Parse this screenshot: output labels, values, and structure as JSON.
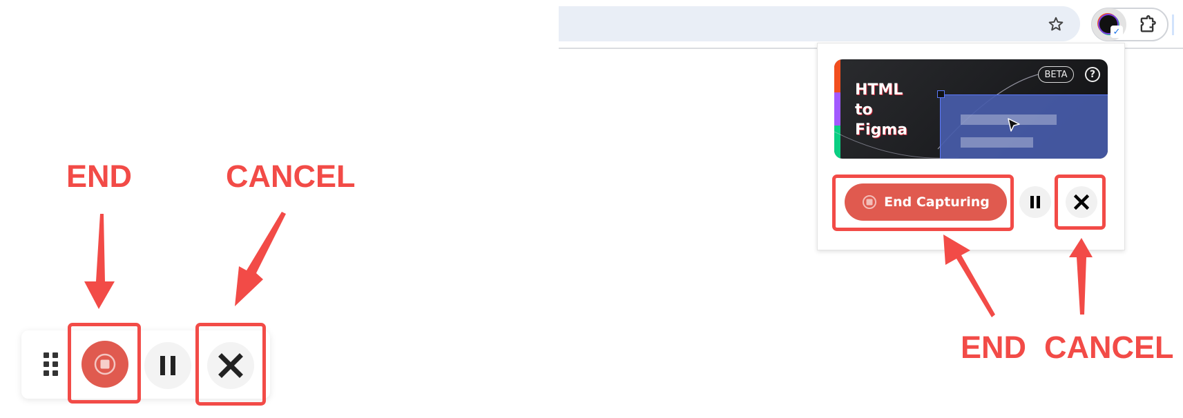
{
  "annotations": {
    "left": {
      "end_label": "END",
      "cancel_label": "CANCEL"
    },
    "right": {
      "end_label": "END",
      "cancel_label": "CANCEL"
    },
    "color": "#F24B47"
  },
  "floating_toolbar": {
    "drag_handle_icon": "drag-dots-icon",
    "end_button_icon": "stop-record-icon",
    "pause_button_icon": "pause-icon",
    "close_button_icon": "close-x-icon"
  },
  "browser": {
    "bookmark_icon": "star-icon",
    "extension_icon": "html-to-figma-extension-icon",
    "extensions_menu_icon": "puzzle-icon",
    "extension_check": "✓"
  },
  "popup": {
    "banner": {
      "title": "HTML\nto\nFigma",
      "badge": "BETA",
      "help": "?"
    },
    "end_capturing_label": "End Capturing",
    "colors": {
      "accent": "#E05A4F",
      "stripe_orange": "#F24E1E",
      "stripe_purple": "#A259FF",
      "stripe_green": "#0ACF83"
    }
  }
}
